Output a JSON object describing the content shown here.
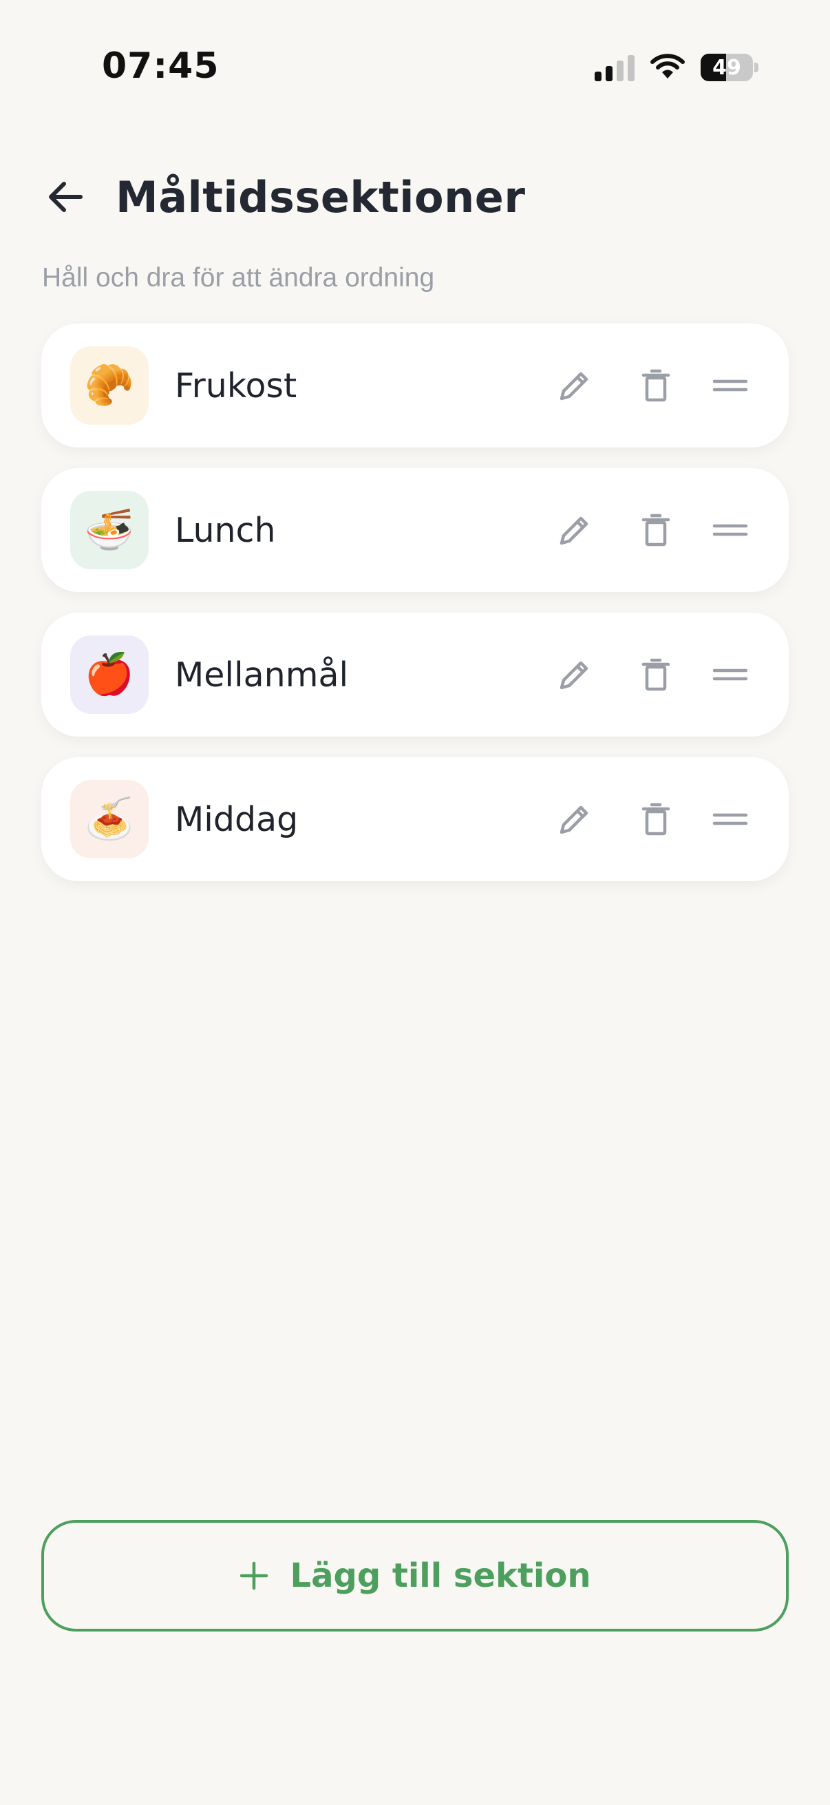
{
  "status_bar": {
    "time": "07:45",
    "battery_percent": "49",
    "battery_level": 0.49,
    "signal_bars_active": 2,
    "signal_bars_total": 4
  },
  "header": {
    "title": "Måltidssektioner",
    "back_icon": "arrow-left-icon"
  },
  "hint": "Håll och dra för att ändra ordning",
  "sections": [
    {
      "name": "Frukost",
      "emoji": "🥐",
      "tile_color": "#fdf3e3"
    },
    {
      "name": "Lunch",
      "emoji": "🍜",
      "tile_color": "#e8f3ec"
    },
    {
      "name": "Mellanmål",
      "emoji": "🍎",
      "tile_color": "#efecf9"
    },
    {
      "name": "Middag",
      "emoji": "🍝",
      "tile_color": "#fcefea"
    }
  ],
  "row_icons": {
    "edit": "pencil-icon",
    "delete": "trash-icon",
    "drag": "drag-handle-icon"
  },
  "add_button": {
    "label": "Lägg till sektion",
    "icon": "plus-icon"
  },
  "colors": {
    "background": "#f8f7f3",
    "accent_green": "#4c9f5c",
    "icon_gray": "#9a9ea6",
    "text_primary": "#242832"
  }
}
